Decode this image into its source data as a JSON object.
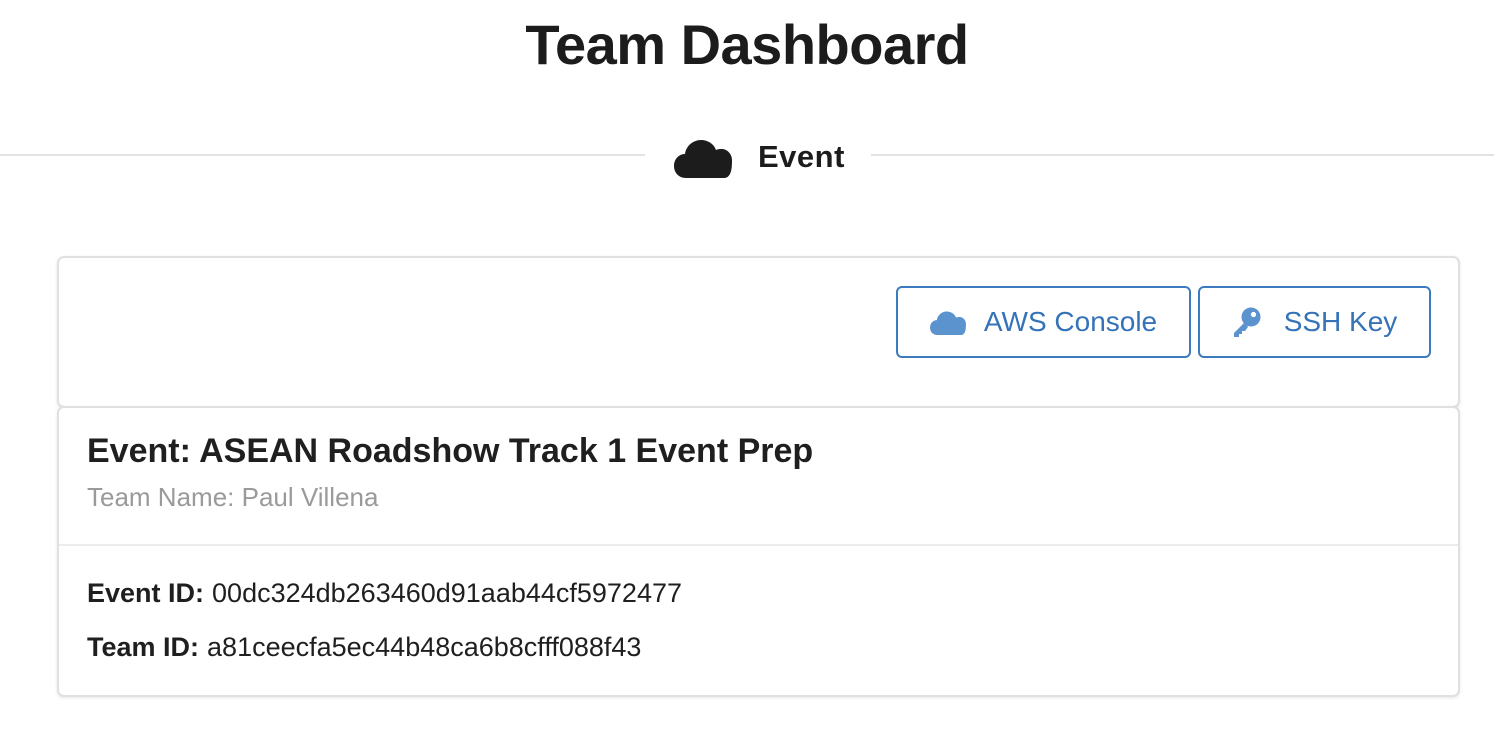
{
  "header": {
    "title": "Team Dashboard"
  },
  "section": {
    "label": "Event",
    "icon": "cloud-icon"
  },
  "actions": {
    "aws_console_label": "AWS Console",
    "aws_console_icon": "cloud-icon",
    "ssh_key_label": "SSH Key",
    "ssh_key_icon": "key-icon",
    "accent_color": "#3d7bbf"
  },
  "event": {
    "title": "Event: ASEAN Roadshow Track 1 Event Prep",
    "team_name": "Team Name: Paul Villena",
    "event_id_label": "Event ID:",
    "event_id": "00dc324db263460d91aab44cf5972477",
    "team_id_label": "Team ID:",
    "team_id": "a81ceecfa5ec44b48ca6b8cfff088f43"
  }
}
